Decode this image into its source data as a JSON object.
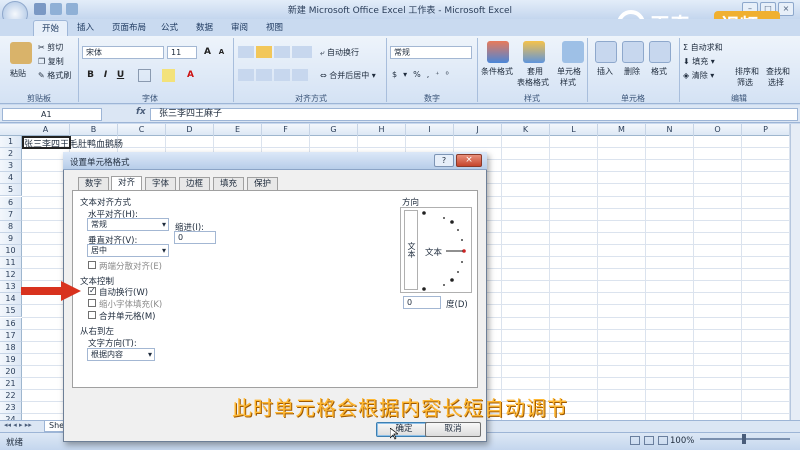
{
  "window": {
    "title": "新建 Microsoft Office Excel 工作表 - Microsoft Excel"
  },
  "tabs": [
    "开始",
    "插入",
    "页面布局",
    "公式",
    "数据",
    "审阅",
    "视图"
  ],
  "ribbon": {
    "clipboard": {
      "paste": "粘贴",
      "cut": "剪切",
      "copy": "复制",
      "format_painter": "格式刷",
      "label": "剪贴板"
    },
    "font": {
      "name": "宋体",
      "size": "11",
      "label": "字体"
    },
    "alignment": {
      "wrap": "自动换行",
      "merge": "合并后居中",
      "label": "对齐方式"
    },
    "number": {
      "format": "常规",
      "label": "数字"
    },
    "styles": {
      "cond": "条件格式",
      "table_l1": "套用",
      "table_l2": "表格格式",
      "cell_l1": "单元格",
      "cell_l2": "样式",
      "label": "样式"
    },
    "cells": {
      "insert": "插入",
      "delete": "删除",
      "format": "格式",
      "label": "单元格"
    },
    "editing": {
      "autosum": "自动求和",
      "fill": "填充",
      "clear": "清除",
      "sort_l1": "排序和",
      "sort_l2": "筛选",
      "find_l1": "查找和",
      "find_l2": "选择",
      "label": "编辑"
    }
  },
  "formula_bar": {
    "cell": "A1",
    "fx": "fx",
    "value": "张三李四王麻子"
  },
  "grid": {
    "columns": [
      "A",
      "B",
      "C",
      "D",
      "E",
      "F",
      "G",
      "H",
      "I",
      "J",
      "K",
      "L",
      "M",
      "N",
      "O",
      "P"
    ],
    "rows": [
      "1",
      "2",
      "3",
      "4",
      "5",
      "6",
      "7",
      "8",
      "9",
      "10",
      "11",
      "12",
      "13",
      "14",
      "15",
      "16",
      "17",
      "18",
      "19",
      "20",
      "21",
      "22",
      "23",
      "24"
    ],
    "a1": "张三李四王毛肚鸭血鹅肠"
  },
  "sheet_tab": "Shee",
  "status": {
    "ready": "就绪",
    "zoom": "100%"
  },
  "dialog": {
    "title": "设置单元格格式",
    "tabs": [
      "数字",
      "对齐",
      "字体",
      "边框",
      "填充",
      "保护"
    ],
    "text_align_section": "文本对齐方式",
    "horizontal_label": "水平对齐(H):",
    "horizontal_value": "常规",
    "indent_label": "缩进(I):",
    "indent_value": "0",
    "vertical_label": "垂直对齐(V):",
    "vertical_value": "居中",
    "justify_distributed": "两端分散对齐(E)",
    "text_control_section": "文本控制",
    "wrap_text": "自动换行(W)",
    "shrink": "缩小字体填充(K)",
    "merge": "合并单元格(M)",
    "rtl_section": "从右到左",
    "text_direction_label": "文字方向(T):",
    "text_direction_value": "根据内容",
    "orientation_section": "方向",
    "vertical_text": "文本",
    "orientation_text": "文本",
    "degrees_value": "0",
    "degrees_label": "度(D)",
    "ok": "确定",
    "cancel": "取消"
  },
  "caption": "此时单元格会根据内容长短自动调节",
  "brand": {
    "name": "天奇",
    "badge": "视频"
  },
  "colors": {
    "accent": "#f0b030",
    "arrow": "#d8321e"
  }
}
